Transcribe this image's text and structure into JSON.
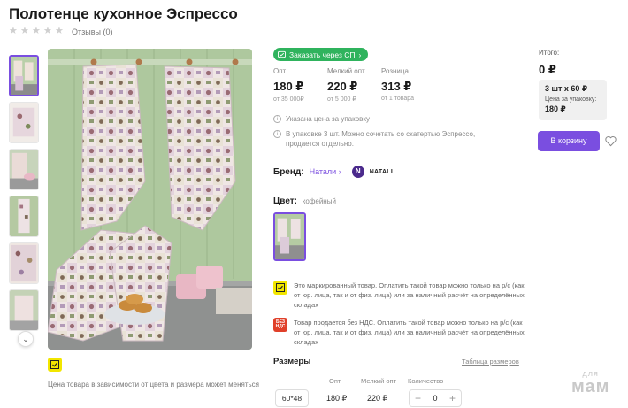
{
  "product": {
    "title": "Полотенце кухонное Эспрессо",
    "reviews": "Отзывы (0)",
    "rating_stars": 0,
    "price_note": "Цена товара в зависимости от цвета и размера может меняться"
  },
  "order": {
    "sp_button": "Заказать через СП"
  },
  "prices": [
    {
      "label": "Опт",
      "value": "180 ₽",
      "sub": "от 35 000₽"
    },
    {
      "label": "Мелкий опт",
      "value": "220 ₽",
      "sub": "от 5 000 ₽"
    },
    {
      "label": "Розница",
      "value": "313 ₽",
      "sub": "от 1 товара"
    }
  ],
  "info": [
    "Указана цена за упаковку",
    "В упаковке 3 шт. Можно сочетать со скатертью Эспрессо, продается отдельно."
  ],
  "brand": {
    "label": "Бренд:",
    "name": "Натали",
    "logo_letter": "N",
    "logo_text": "NATALI"
  },
  "color": {
    "label": "Цвет:",
    "value": "кофейный"
  },
  "notices": [
    {
      "icon": "marking-icon",
      "text": "Это маркированный товар. Оплатить такой товар можно только на р/с (как от юр. лица, так и от физ. лица) или за наличный расчёт на определённых складах"
    },
    {
      "icon": "no-vat-icon",
      "icon_text": [
        "БЕЗ",
        "НДС"
      ],
      "text": "Товар продается без НДС. Оплатить такой товар можно только на р/с (как от юр. лица, так и от физ. лица) или за наличный расчёт на определённых складах"
    }
  ],
  "sizes": {
    "title": "Размеры",
    "table_link": "Таблица размеров",
    "headers": [
      "Опт",
      "Мелкий опт",
      "Количество"
    ],
    "rows": [
      {
        "size": "60*48",
        "opt": "180 ₽",
        "small_opt": "220 ₽",
        "quantity": "0",
        "minus": "−",
        "plus": "+"
      }
    ]
  },
  "summary": {
    "total_label": "Итого:",
    "total_value": "0 ₽",
    "pack": "3 шт х 60 ₽",
    "pack_price_label": "Цена за упаковку:",
    "pack_price": "180 ₽",
    "cart_button": "В корзину"
  },
  "watermark": [
    "для",
    "мам"
  ],
  "colors": {
    "accent": "#7a4ee0",
    "sp_green": "#2fb35d",
    "marking_yellow": "#f2e600",
    "no_vat_red": "#e0402a"
  }
}
